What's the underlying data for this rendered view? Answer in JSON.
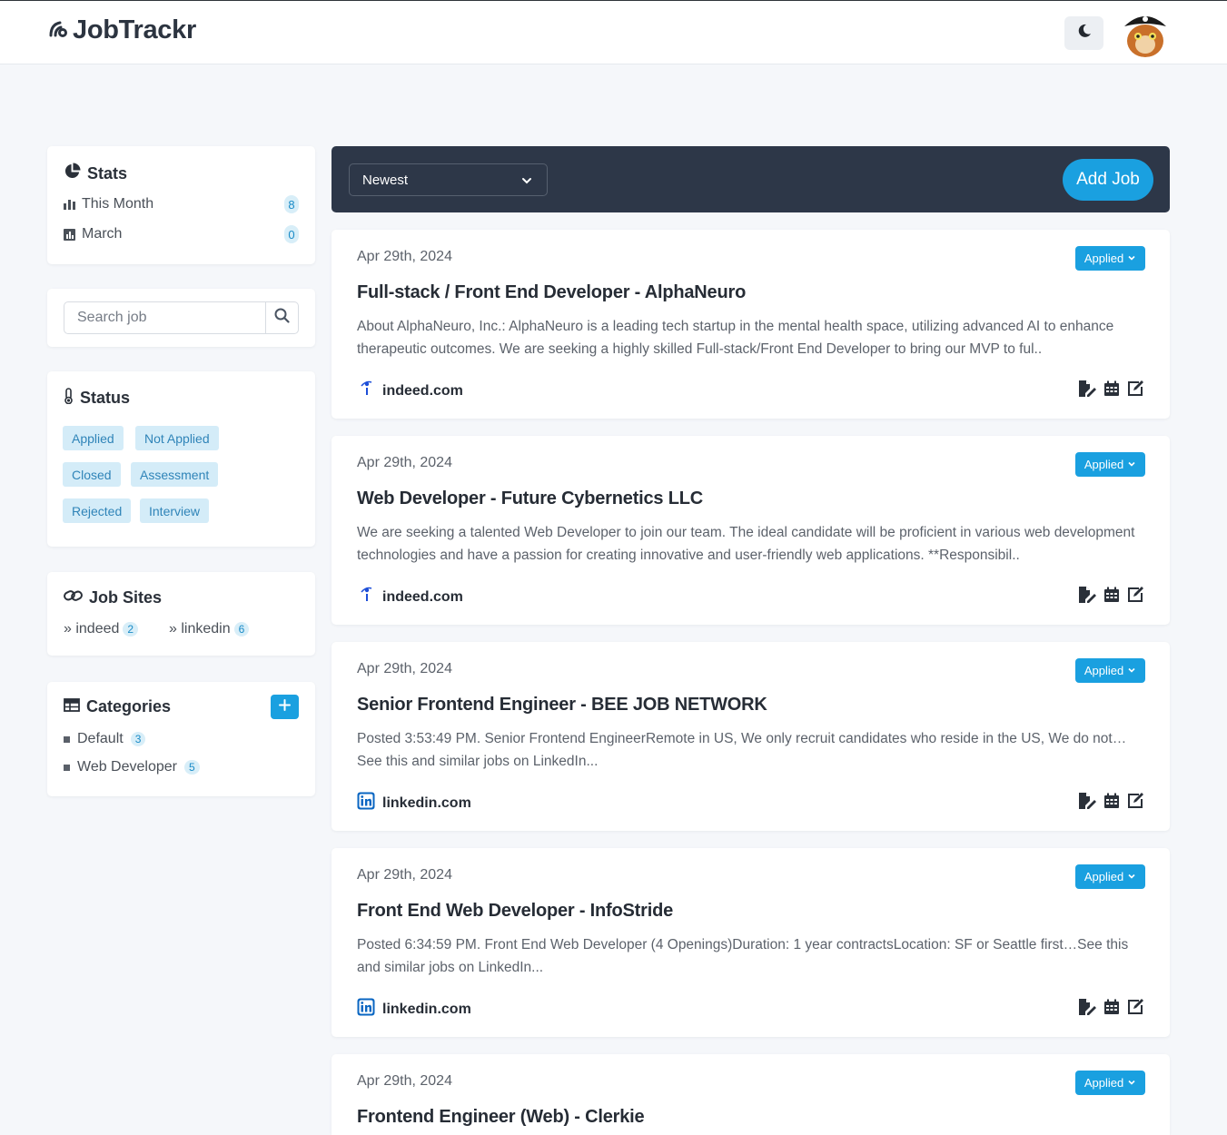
{
  "app": {
    "name": "JobTrackr"
  },
  "stats": {
    "title": "Stats",
    "items": [
      {
        "label": "This Month",
        "count": "8"
      },
      {
        "label": "March",
        "count": "0"
      }
    ]
  },
  "search": {
    "placeholder": "Search job"
  },
  "status": {
    "title": "Status",
    "tags": [
      "Applied",
      "Not Applied",
      "Closed",
      "Assessment",
      "Rejected",
      "Interview"
    ]
  },
  "job_sites": {
    "title": "Job Sites",
    "items": [
      {
        "label": "» indeed",
        "count": "2"
      },
      {
        "label": "» linkedin",
        "count": "6"
      }
    ]
  },
  "categories": {
    "title": "Categories",
    "items": [
      {
        "label": "Default",
        "count": "3"
      },
      {
        "label": "Web Developer",
        "count": "5"
      }
    ]
  },
  "toolbar": {
    "sort_value": "Newest",
    "add_job_label": "Add Job"
  },
  "jobs": [
    {
      "date": "Apr 29th, 2024",
      "title": "Full-stack / Front End Developer - AlphaNeuro",
      "description": "About AlphaNeuro, Inc.: AlphaNeuro is a leading tech startup in the mental health space, utilizing advanced AI to enhance therapeutic outcomes. We are seeking a highly skilled Full-stack/Front End Developer to bring our MVP to ful..",
      "site": "indeed.com",
      "status": "Applied"
    },
    {
      "date": "Apr 29th, 2024",
      "title": "Web Developer - Future Cybernetics LLC",
      "description": "We are seeking a talented Web Developer to join our team. The ideal candidate will be proficient in various web development technologies and have a passion for creating innovative and user-friendly web applications. **Responsibil..",
      "site": "indeed.com",
      "status": "Applied"
    },
    {
      "date": "Apr 29th, 2024",
      "title": "Senior Frontend Engineer - BEE JOB NETWORK",
      "description": "Posted 3:53:49 PM. Senior Frontend EngineerRemote in US, We only recruit candidates who reside in the US, We do not…See this and similar jobs on LinkedIn...",
      "site": "linkedin.com",
      "status": "Applied"
    },
    {
      "date": "Apr 29th, 2024",
      "title": "Front End Web Developer - InfoStride",
      "description": "Posted 6:34:59 PM. Front End Web Developer (4 Openings)Duration: 1 year contractsLocation: SF or Seattle first…See this and similar jobs on LinkedIn...",
      "site": "linkedin.com",
      "status": "Applied"
    },
    {
      "date": "Apr 29th, 2024",
      "title": "Frontend Engineer (Web) - Clerkie",
      "description": "",
      "site": "",
      "status": "Applied"
    }
  ]
}
